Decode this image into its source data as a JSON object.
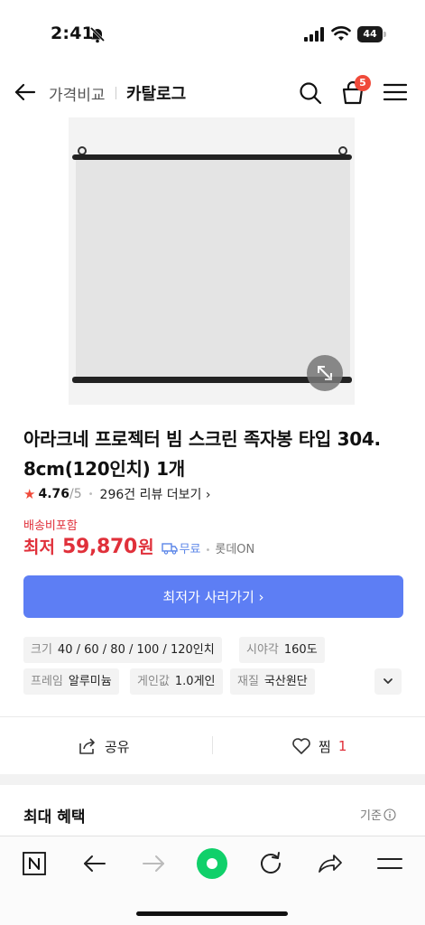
{
  "status_bar": {
    "time": "2:41",
    "battery": "44"
  },
  "header": {
    "back_label": "←",
    "sub": "가격비교",
    "title": "카탈로그",
    "cart_count": "5"
  },
  "product": {
    "title": "아라크네 프로젝터 빔 스크린 족자봉 타입 304. 8cm(120인치) 1개",
    "rating": "4.76",
    "rating_max": "/5",
    "reviews": "296건 리뷰 더보기 ›",
    "shipping_note": "배송비포함",
    "price_prefix": "최저",
    "price": "59,870",
    "price_unit": "원",
    "delivery": "무료",
    "seller": "롯데ON",
    "cta": "최저가 사러가기 ›"
  },
  "specs": [
    {
      "key": "크기",
      "value": "40 / 60 / 80 / 100 / 120인치"
    },
    {
      "key": "시야각",
      "value": "160도"
    },
    {
      "key": "프레임",
      "value": "알루미늄"
    },
    {
      "key": "게인값",
      "value": "1.0게인"
    },
    {
      "key": "재질",
      "value": "국산원단"
    }
  ],
  "actions": {
    "share": "공유",
    "like": "찜",
    "like_count": "1"
  },
  "benefits": {
    "title": "최대 혜택",
    "standard": "기준"
  },
  "colors": {
    "accent_blue": "#5d7ef4",
    "price_red": "#e0303a",
    "badge_red": "#f04a3a",
    "like_red": "#e0303a"
  },
  "icons": {
    "status": [
      "bell-off-icon",
      "signal-icon",
      "wifi-icon",
      "battery-icon"
    ],
    "header": [
      "back-arrow-icon",
      "search-icon",
      "cart-icon",
      "hamburger-menu-icon"
    ],
    "bottom_bar": [
      "naver-n-icon",
      "back-icon",
      "forward-icon",
      "green-home-icon",
      "refresh-icon",
      "share-icon",
      "menu-icon"
    ]
  }
}
